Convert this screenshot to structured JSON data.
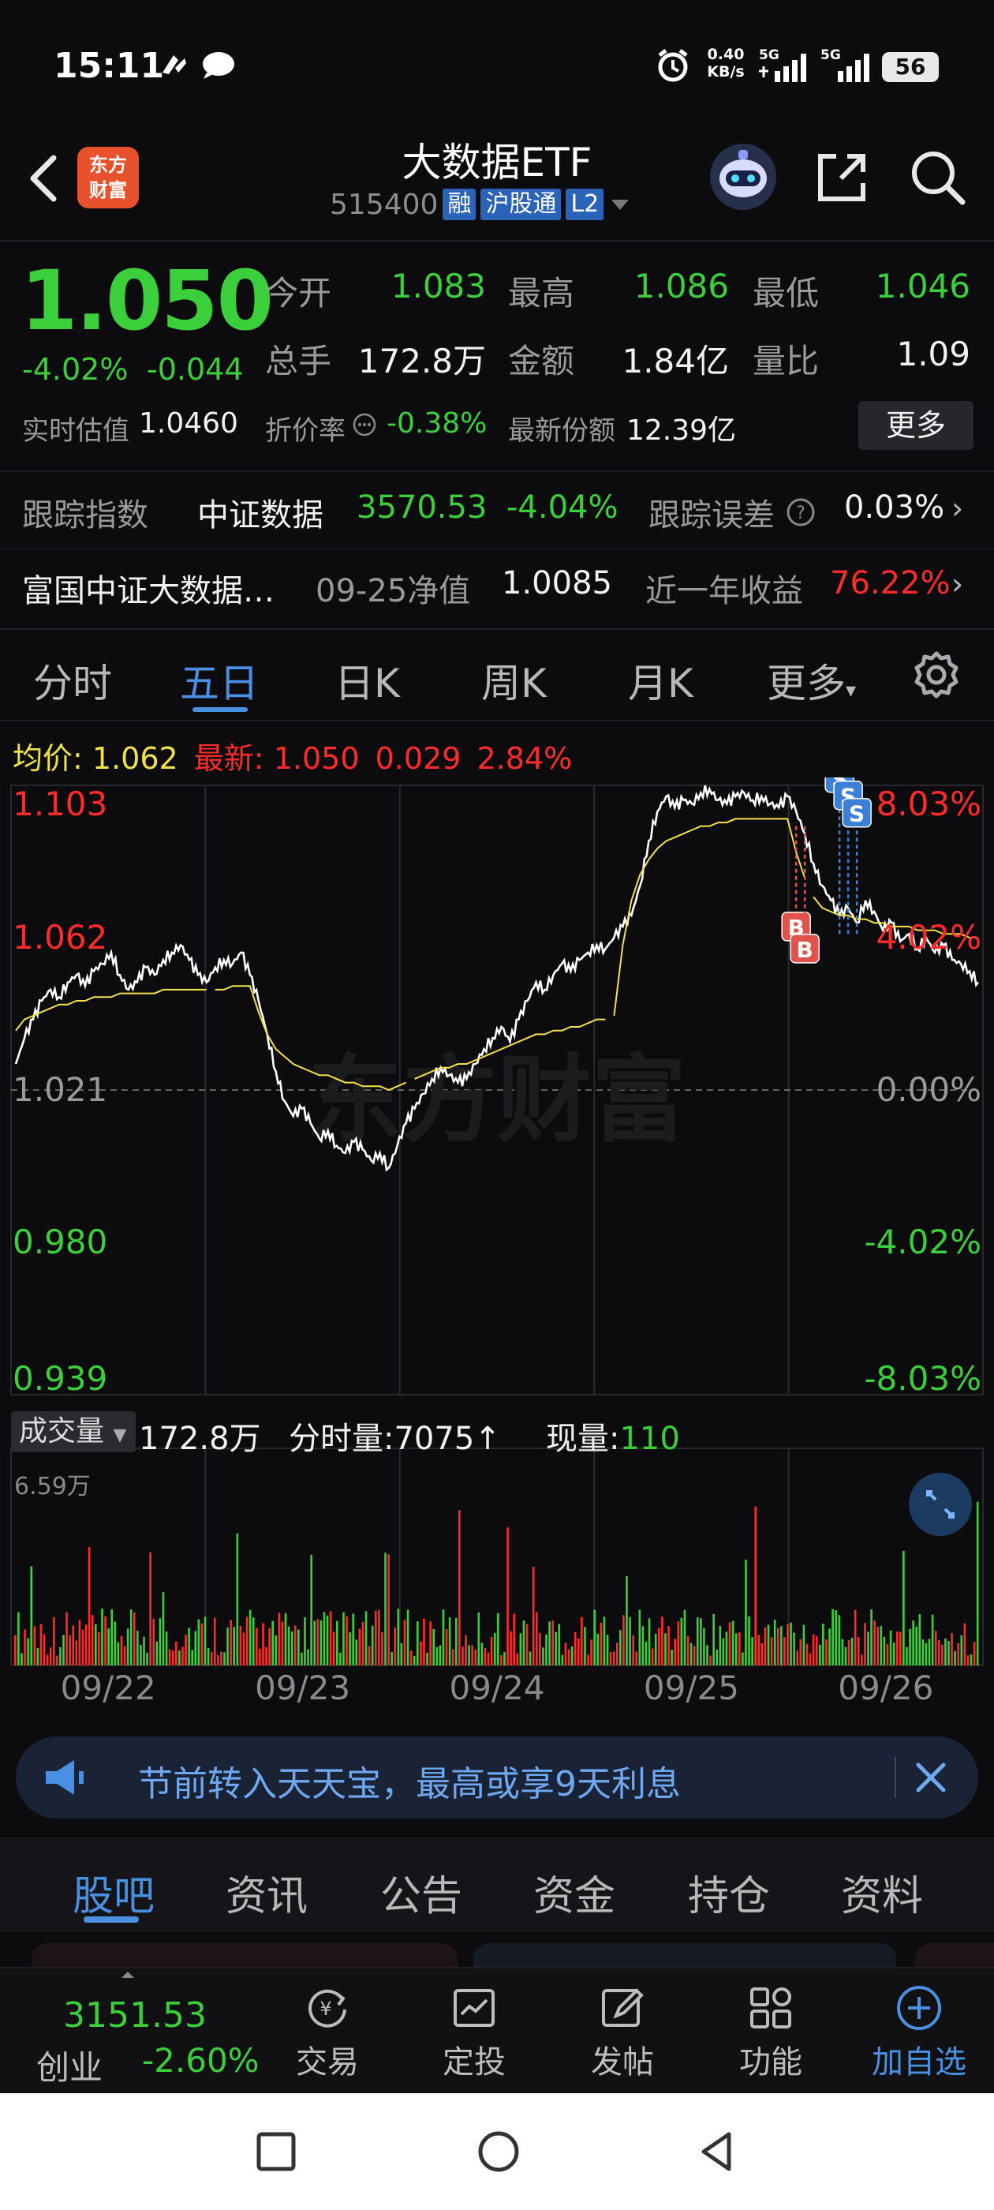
{
  "status_bar": {
    "time": "15:11",
    "net_speed_value": "0.40",
    "net_speed_unit": "KB/s",
    "signal_1": "5G",
    "signal_2": "5G",
    "battery": "56"
  },
  "header": {
    "title": "大数据ETF",
    "code": "515400",
    "tags": [
      "融",
      "沪股通",
      "L2"
    ],
    "logo_text": "东方财富"
  },
  "quote": {
    "price": "1.050",
    "change_pct": "-4.02%",
    "change": "-0.044",
    "stats": [
      {
        "label": "今开",
        "value": "1.083"
      },
      {
        "label": "最高",
        "value": "1.086"
      },
      {
        "label": "最低",
        "value": "1.046"
      },
      {
        "label": "总手",
        "value": "172.8万"
      },
      {
        "label": "金额",
        "value": "1.84亿"
      },
      {
        "label": "量比",
        "value": "1.09"
      }
    ],
    "iopv_label": "实时估值",
    "iopv_value": "1.0460",
    "discount_label": "折价率",
    "discount_value": "-0.38%",
    "shares_label": "最新份额",
    "shares_value": "12.39亿",
    "more_label": "更多"
  },
  "tracking": {
    "label": "跟踪指数",
    "index_name": "中证数据",
    "index_value": "3570.53",
    "index_pct": "-4.04%",
    "error_label": "跟踪误差",
    "error_value": "0.03%"
  },
  "fund": {
    "name": "富国中证大数据…",
    "nav_label": "09-25净值",
    "nav_value": "1.0085",
    "return_label": "近一年收益",
    "return_value": "76.22%"
  },
  "period_tabs": [
    "分时",
    "五日",
    "日K",
    "周K",
    "月K",
    "更多"
  ],
  "active_period": "五日",
  "chart_legend": {
    "avg_label": "均价:",
    "avg_value": "1.062",
    "latest_label": "最新:",
    "latest_value": "1.050",
    "latest_change": "0.029",
    "latest_pct": "2.84%"
  },
  "chart_data": {
    "type": "line",
    "title": "",
    "x": [
      "09/22",
      "09/23",
      "09/24",
      "09/25",
      "09/26"
    ],
    "y_ticks_left": [
      "1.103",
      "1.062",
      "1.021",
      "0.980",
      "0.939"
    ],
    "y_ticks_right": [
      "8.03%",
      "4.02%",
      "0.00%",
      "-4.02%",
      "-8.03%"
    ],
    "ylim": [
      0.939,
      1.103
    ],
    "reference": 1.021,
    "series": [
      {
        "values": [
          1.028,
          1.035,
          1.04,
          1.045,
          1.048,
          1.046,
          1.05,
          1.052,
          1.049,
          1.053,
          1.055,
          1.058,
          1.052,
          1.048,
          1.05,
          1.054,
          1.052,
          1.056,
          1.058,
          1.06,
          1.056,
          1.052,
          1.05,
          1.054,
          1.056,
          1.055,
          1.058,
          1.052,
          1.045,
          1.036,
          1.026,
          1.018,
          1.014,
          1.016,
          1.012,
          1.008,
          1.01,
          1.006,
          1.004,
          1.007,
          1.005,
          1.002,
          1.004,
          1.0,
          1.006,
          1.012,
          1.016,
          1.02,
          1.024,
          1.027,
          1.025,
          1.023,
          1.024,
          1.028,
          1.032,
          1.035,
          1.038,
          1.034,
          1.04,
          1.045,
          1.05,
          1.048,
          1.052,
          1.055,
          1.053,
          1.056,
          1.058,
          1.06,
          1.059,
          1.062,
          1.065,
          1.068,
          1.076,
          1.088,
          1.096,
          1.1,
          1.097,
          1.099,
          1.098,
          1.101,
          1.102,
          1.099,
          1.098,
          1.1,
          1.101,
          1.099,
          1.1,
          1.098,
          1.097,
          1.1,
          1.096,
          1.09,
          1.082,
          1.076,
          1.072,
          1.068,
          1.07,
          1.066,
          1.072,
          1.069,
          1.064,
          1.066,
          1.061,
          1.063,
          1.059,
          1.062,
          1.058,
          1.06,
          1.056,
          1.055,
          1.053,
          1.05
        ]
      },
      {
        "values": [
          1.037,
          1.04,
          1.041,
          1.042,
          1.043,
          1.044,
          1.044,
          1.045,
          1.045,
          1.046,
          1.046,
          1.046,
          1.047,
          1.047,
          1.047,
          1.047,
          1.047,
          1.048,
          1.048,
          1.048,
          1.048,
          1.048,
          1.048,
          1.048,
          1.048,
          1.049,
          1.049,
          1.049,
          1.042,
          1.036,
          1.032,
          1.03,
          1.028,
          1.027,
          1.026,
          1.025,
          1.025,
          1.024,
          1.023,
          1.023,
          1.022,
          1.022,
          1.022,
          1.021,
          1.022,
          1.023,
          1.024,
          1.025,
          1.026,
          1.027,
          1.027,
          1.028,
          1.028,
          1.029,
          1.03,
          1.031,
          1.032,
          1.033,
          1.034,
          1.035,
          1.036,
          1.036,
          1.037,
          1.037,
          1.038,
          1.038,
          1.039,
          1.04,
          1.04,
          1.041,
          1.06,
          1.072,
          1.079,
          1.083,
          1.086,
          1.088,
          1.089,
          1.09,
          1.091,
          1.092,
          1.092,
          1.093,
          1.093,
          1.094,
          1.094,
          1.094,
          1.094,
          1.094,
          1.094,
          1.094,
          1.085,
          1.078,
          1.073,
          1.07,
          1.069,
          1.068,
          1.068,
          1.067,
          1.067,
          1.066,
          1.066,
          1.065,
          1.065,
          1.065,
          1.064,
          1.064,
          1.064,
          1.063,
          1.063,
          1.063,
          1.062,
          1.062
        ]
      }
    ],
    "markers": [
      {
        "label": "B",
        "index": 90
      },
      {
        "label": "B",
        "index": 91
      },
      {
        "label": "S",
        "index": 95
      },
      {
        "label": "S",
        "index": 96
      },
      {
        "label": "S",
        "index": 97
      }
    ],
    "grid": true,
    "watermark": "东方财富"
  },
  "volume": {
    "selector": "成交量",
    "total": "172.8万",
    "minute_label": "分时量:",
    "minute_value": "7075",
    "now_label": "现量:",
    "now_value": "110",
    "max_label": "6.59万"
  },
  "banner": {
    "text": "节前转入天天宝，最高或享9天利息"
  },
  "content_tabs": [
    "股吧",
    "资讯",
    "公告",
    "资金",
    "持仓",
    "资料"
  ],
  "active_content_tab": "股吧",
  "toolbar": {
    "index_value": "3151.53",
    "index_name": "创业",
    "index_pct": "-2.60%",
    "items": [
      {
        "label": "交易",
        "icon": "yuan-refresh-icon"
      },
      {
        "label": "定投",
        "icon": "chart-plan-icon"
      },
      {
        "label": "发帖",
        "icon": "pen-edit-icon"
      },
      {
        "label": "功能",
        "icon": "grid-apps-icon"
      },
      {
        "label": "加自选",
        "icon": "plus-circle-icon"
      }
    ]
  },
  "colors": {
    "up": "#ff2a2a",
    "down": "#3ccf3c",
    "accent": "#4a90e2",
    "avg_line": "#f2e24a"
  }
}
